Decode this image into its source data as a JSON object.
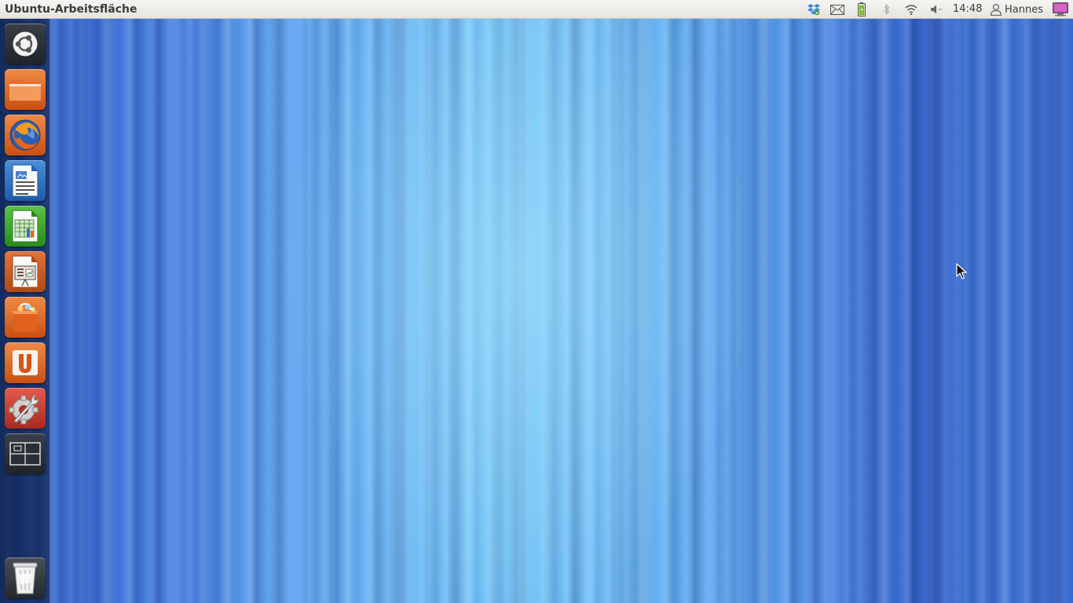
{
  "panel": {
    "window_title": "Ubuntu-Arbeitsfläche",
    "clock": "14:48",
    "user_name": "Hannes",
    "indicators": [
      "dropbox-icon",
      "mail-icon",
      "battery-icon",
      "bluetooth-icon",
      "wifi-icon",
      "volume-icon",
      "session-icon"
    ]
  },
  "launcher": {
    "items": [
      {
        "icon": "ubuntu-logo-icon",
        "name": "dash-home"
      },
      {
        "icon": "folder-icon",
        "name": "files"
      },
      {
        "icon": "firefox-icon",
        "name": "firefox"
      },
      {
        "icon": "writer-document-icon",
        "name": "libreoffice-writer"
      },
      {
        "icon": "calc-spreadsheet-icon",
        "name": "libreoffice-calc"
      },
      {
        "icon": "impress-presentation-icon",
        "name": "libreoffice-impress"
      },
      {
        "icon": "shopping-bag-icon",
        "name": "software-center"
      },
      {
        "icon": "ubuntu-one-icon",
        "name": "ubuntu-one"
      },
      {
        "icon": "gear-wrench-icon",
        "name": "system-settings"
      },
      {
        "icon": "workspace-switcher-icon",
        "name": "workspace-switcher"
      },
      {
        "icon": "trash-icon",
        "name": "trash"
      }
    ]
  },
  "colors": {
    "panel_bg": "#ebe9e5",
    "panel_text": "#3c3c3c",
    "launcher_bg": "#13284f",
    "wallpaper_primary": "#4a86e6",
    "wallpaper_light": "#72c6fa"
  }
}
